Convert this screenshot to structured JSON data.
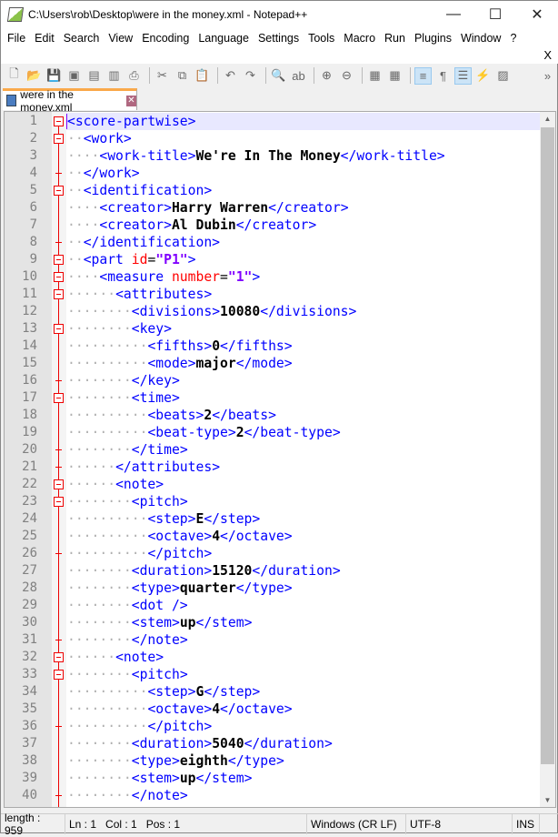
{
  "window": {
    "title": "C:\\Users\\rob\\Desktop\\were in the money.xml - Notepad++",
    "minimize": "—",
    "maximize": "☐",
    "close": "✕"
  },
  "menu": [
    "File",
    "Edit",
    "Search",
    "View",
    "Encoding",
    "Language",
    "Settings",
    "Tools",
    "Macro",
    "Run",
    "Plugins",
    "Window",
    "?"
  ],
  "menu_close": "X",
  "toolbar": [
    {
      "icon": "new-file-icon",
      "g": "🗋"
    },
    {
      "icon": "open-file-icon",
      "g": "📂"
    },
    {
      "icon": "save-icon",
      "g": "💾"
    },
    {
      "icon": "save-all-icon",
      "g": "▣"
    },
    {
      "icon": "close-icon",
      "g": "▤"
    },
    {
      "icon": "close-all-icon",
      "g": "▥"
    },
    {
      "icon": "print-icon",
      "g": "⎙"
    },
    {
      "sep": true
    },
    {
      "icon": "cut-icon",
      "g": "✂"
    },
    {
      "icon": "copy-icon",
      "g": "⧉"
    },
    {
      "icon": "paste-icon",
      "g": "📋"
    },
    {
      "sep": true
    },
    {
      "icon": "undo-icon",
      "g": "↶"
    },
    {
      "icon": "redo-icon",
      "g": "↷"
    },
    {
      "sep": true
    },
    {
      "icon": "find-icon",
      "g": "🔍"
    },
    {
      "icon": "replace-icon",
      "g": "ab"
    },
    {
      "sep": true
    },
    {
      "icon": "zoom-in-icon",
      "g": "⊕"
    },
    {
      "icon": "zoom-out-icon",
      "g": "⊖"
    },
    {
      "sep": true
    },
    {
      "icon": "sync-vertical-icon",
      "g": "▦"
    },
    {
      "icon": "sync-horizontal-icon",
      "g": "▦"
    },
    {
      "sep": true
    },
    {
      "icon": "word-wrap-icon",
      "g": "≡",
      "on": true
    },
    {
      "icon": "show-all-chars-icon",
      "g": "¶"
    },
    {
      "icon": "indent-guide-icon",
      "g": "☰",
      "on": true
    },
    {
      "icon": "udl-icon",
      "g": "⚡"
    },
    {
      "icon": "doc-map-icon",
      "g": "▨"
    },
    {
      "icon": "more-icon",
      "g": "»"
    }
  ],
  "tab": {
    "label": "were in the money.xml"
  },
  "lines": [
    {
      "n": "1",
      "i": 0,
      "t": "<score-partwise>",
      "f": "open"
    },
    {
      "n": "2",
      "i": 2,
      "t": "<work>",
      "f": "open"
    },
    {
      "n": "3",
      "i": 4,
      "t": "<work-title>We're In The Money</work-title>"
    },
    {
      "n": "4",
      "i": 2,
      "t": "</work>",
      "f": "end"
    },
    {
      "n": "5",
      "i": 2,
      "t": "<identification>",
      "f": "open"
    },
    {
      "n": "6",
      "i": 4,
      "t": "<creator>Harry Warren</creator>"
    },
    {
      "n": "7",
      "i": 4,
      "t": "<creator>Al Dubin</creator>"
    },
    {
      "n": "8",
      "i": 2,
      "t": "</identification>",
      "f": "end"
    },
    {
      "n": "9",
      "i": 2,
      "t": "<part id=\"P1\">",
      "f": "open"
    },
    {
      "n": "10",
      "i": 4,
      "t": "<measure number=\"1\">",
      "f": "open"
    },
    {
      "n": "11",
      "i": 6,
      "t": "<attributes>",
      "f": "open"
    },
    {
      "n": "12",
      "i": 8,
      "t": "<divisions>10080</divisions>"
    },
    {
      "n": "13",
      "i": 8,
      "t": "<key>",
      "f": "open"
    },
    {
      "n": "14",
      "i": 10,
      "t": "<fifths>0</fifths>"
    },
    {
      "n": "15",
      "i": 10,
      "t": "<mode>major</mode>"
    },
    {
      "n": "16",
      "i": 8,
      "t": "</key>",
      "f": "end"
    },
    {
      "n": "17",
      "i": 8,
      "t": "<time>",
      "f": "open"
    },
    {
      "n": "18",
      "i": 10,
      "t": "<beats>2</beats>"
    },
    {
      "n": "19",
      "i": 10,
      "t": "<beat-type>2</beat-type>"
    },
    {
      "n": "20",
      "i": 8,
      "t": "</time>",
      "f": "end"
    },
    {
      "n": "21",
      "i": 6,
      "t": "</attributes>",
      "f": "end"
    },
    {
      "n": "22",
      "i": 6,
      "t": "<note>",
      "f": "open"
    },
    {
      "n": "23",
      "i": 8,
      "t": "<pitch>",
      "f": "open"
    },
    {
      "n": "24",
      "i": 10,
      "t": "<step>E</step>"
    },
    {
      "n": "25",
      "i": 10,
      "t": "<octave>4</octave>"
    },
    {
      "n": "26",
      "i": 10,
      "t": "</pitch>",
      "f": "end"
    },
    {
      "n": "27",
      "i": 8,
      "t": "<duration>15120</duration>"
    },
    {
      "n": "28",
      "i": 8,
      "t": "<type>quarter</type>"
    },
    {
      "n": "29",
      "i": 8,
      "t": "<dot />"
    },
    {
      "n": "30",
      "i": 8,
      "t": "<stem>up</stem>"
    },
    {
      "n": "31",
      "i": 8,
      "t": "</note>",
      "f": "end"
    },
    {
      "n": "32",
      "i": 6,
      "t": "<note>",
      "f": "open"
    },
    {
      "n": "33",
      "i": 8,
      "t": "<pitch>",
      "f": "open"
    },
    {
      "n": "34",
      "i": 10,
      "t": "<step>G</step>"
    },
    {
      "n": "35",
      "i": 10,
      "t": "<octave>4</octave>"
    },
    {
      "n": "36",
      "i": 10,
      "t": "</pitch>",
      "f": "end"
    },
    {
      "n": "37",
      "i": 8,
      "t": "<duration>5040</duration>"
    },
    {
      "n": "38",
      "i": 8,
      "t": "<type>eighth</type>"
    },
    {
      "n": "39",
      "i": 8,
      "t": "<stem>up</stem>"
    },
    {
      "n": "40",
      "i": 8,
      "t": "</note>",
      "f": "end"
    }
  ],
  "status": {
    "length": "length : 959",
    "ln": "Ln : 1",
    "col": "Col : 1",
    "pos": "Pos : 1",
    "eol": "Windows (CR LF)",
    "encoding": "UTF-8",
    "mode": "INS"
  }
}
